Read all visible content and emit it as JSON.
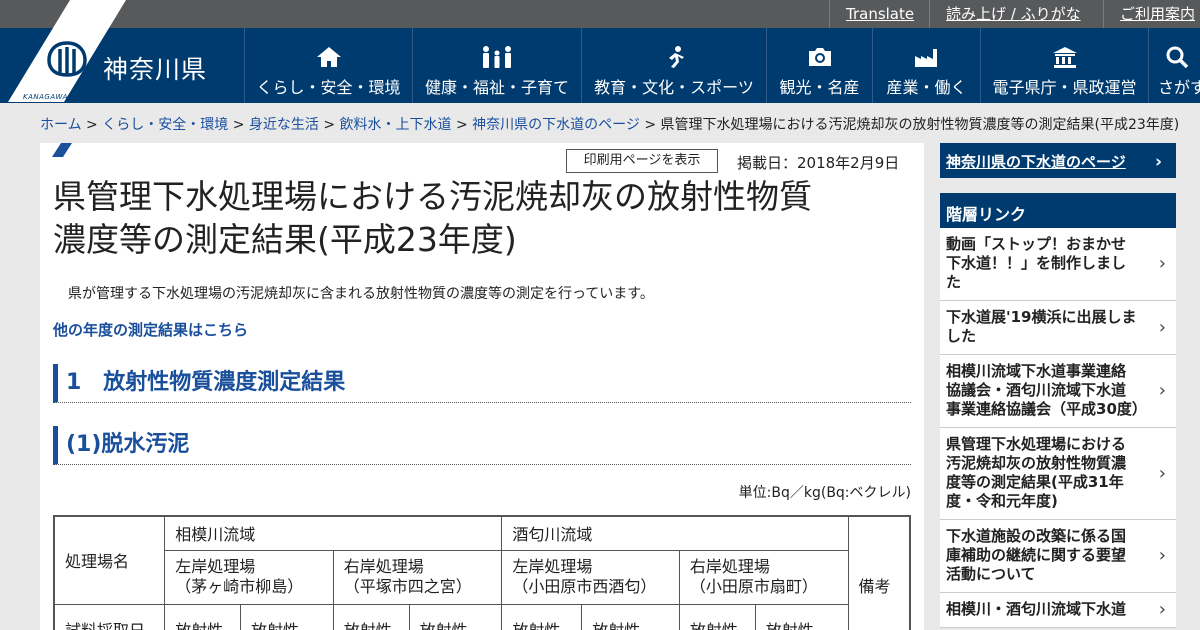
{
  "utility_bar": {
    "translate": "Translate",
    "read_aloud": "読み上げ / ふりがな",
    "guide": "ご利用案内"
  },
  "header": {
    "site_name": "神奈川県",
    "logo_caption": "KANAGAWA",
    "nav": [
      {
        "label": "くらし・安全・環境",
        "icon": "house-icon"
      },
      {
        "label": "健康・福祉・子育て",
        "icon": "family-icon"
      },
      {
        "label": "教育・文化・スポーツ",
        "icon": "runner-icon"
      },
      {
        "label": "観光・名産",
        "icon": "camera-icon"
      },
      {
        "label": "産業・働く",
        "icon": "factory-icon"
      },
      {
        "label": "電子県庁・県政運営",
        "icon": "government-building-icon"
      },
      {
        "label": "さがす",
        "icon": "search-icon"
      }
    ]
  },
  "breadcrumb": {
    "items": [
      "ホーム",
      "くらし・安全・環境",
      "身近な生活",
      "飲料水・上下水道",
      "神奈川県の下水道のページ"
    ],
    "separator": ">",
    "current": "県管理下水処理場における汚泥焼却灰の放射性物質濃度等の測定結果(平成23年度)"
  },
  "page": {
    "print_button": "印刷用ページを表示",
    "posted_date": "掲載日：2018年2月9日",
    "title_line1": "県管理下水処理場における汚泥焼却灰の放射性物質",
    "title_line2": "濃度等の測定結果(平成23年度)",
    "intro": "県が管理する下水処理場の汚泥焼却灰に含まれる放射性物質の濃度等の測定を行っています。",
    "other_years_link": "他の年度の測定結果はこちら",
    "section1": "1　放射性物質濃度測定結果",
    "section1_1": "(1)脱水汚泥",
    "unit_note": "単位:Bq／kg(Bq:ベクレル)"
  },
  "table": {
    "row_header_plant": "処理場名",
    "row_header_date": "試料採取日",
    "basins": [
      "相模川流域",
      "酒匂川流域"
    ],
    "plants": [
      {
        "name": "左岸処理場",
        "location": "（茅ヶ崎市柳島）"
      },
      {
        "name": "右岸処理場",
        "location": "（平塚市四之宮）"
      },
      {
        "name": "左岸処理場",
        "location": "（小田原市西酒匂）"
      },
      {
        "name": "右岸処理場",
        "location": "（小田原市扇町）"
      }
    ],
    "remarks_header": "備考",
    "sub_header": "放射性"
  },
  "sidebar": {
    "top_link": "神奈川県の下水道のページ",
    "section_title": "階層リンク",
    "links": [
      "動画「ストップ！おまかせ下水道！！」を制作しました",
      "下水道展'19横浜に出展しました",
      "相模川流域下水道事業連絡協議会・酒匂川流域下水道事業連絡協議会（平成30度）",
      "県管理下水処理場における汚泥焼却灰の放射性物質濃度等の測定結果(平成31年度・令和元年度)",
      "下水道施設の改築に係る国庫補助の継続に関する要望活動について",
      "相模川・酒匂川流域下水道"
    ]
  },
  "colors": {
    "header_navy": "#003b6f",
    "utility_gray": "#58595b",
    "link_blue": "#1a4f9c",
    "page_bg": "#e9e9e9"
  }
}
